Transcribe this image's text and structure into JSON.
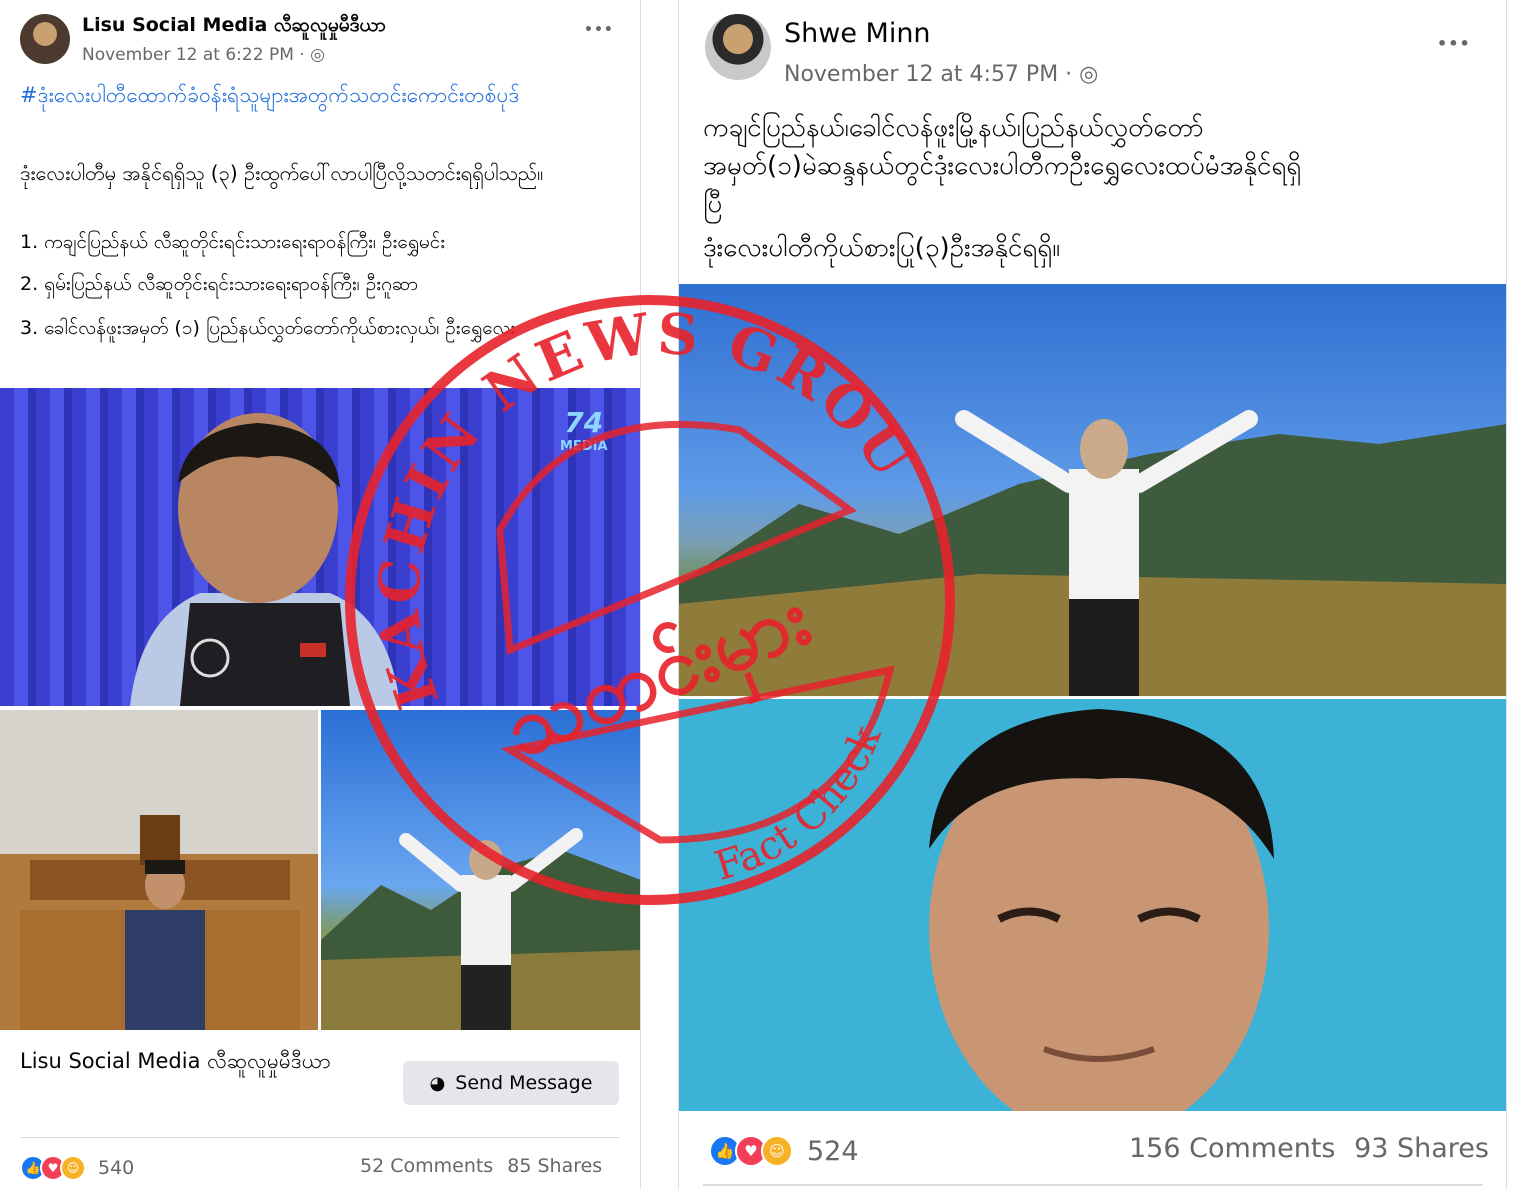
{
  "left": {
    "author": "Lisu Social Media လီဆူလူမှုမီဒီယာ",
    "date": "November 12 at 6:22 PM · ",
    "menu": "•••",
    "hashtag": "#ဒုံးလေးပါတီထောက်ခံဝန်းရံသူများအတွက်သတင်းကောင်းတစ်ပုဒ်",
    "intro": "ဒုံးလေးပါတီမှ အနိုင်ရရှိသူ (၃) ဦးထွက်ပေါ်လာပါပြီလို့သတင်းရရှိပါသည်။",
    "items": [
      "1. ကချင်ပြည်နယ် လီဆူတိုင်းရင်းသားရေးရာဝန်ကြီး၊ ဦးရွှေမင်း",
      "2. ရှမ်းပြည်နယ် လီဆူတိုင်းရင်းသားရေးရာဝန်ကြီး၊ ဦးဂူဆာ",
      "3. ခေါင်လန်ဖူးအမှတ် (၁) ပြည်နယ်လွှတ်တော်ကိုယ်စားလှယ်၊ ဦးရွှေလေး"
    ],
    "photo_logo": "74",
    "photo_logo_sub": "MEDIA",
    "page_name": "Lisu Social Media လီဆူလူမှုမီဒီယာ",
    "send_message": "Send Message",
    "reaction_count": "540",
    "comments": "52 Comments",
    "shares": "85 Shares"
  },
  "right": {
    "author": "Shwe Minn",
    "date": "November 12 at 4:57 PM · ",
    "menu": "•••",
    "text_lines": [
      "ကချင်ပြည်နယ်၊ခေါင်လန်ဖူးမြို့နယ်၊ပြည်နယ်လွှတ်တော်",
      "အမှတ်(၁)မဲဆန္ဒနယ်တွင်ဒုံးလေးပါတီကဦးရွှေလေးထပ်မံအနိုင်ရရှိ",
      "ပြီ",
      "ဒုံးလေးပါတီကိုယ်စားပြု(၃)ဦးအနိုင်ရရှိ။"
    ],
    "reaction_count": "524",
    "comments": "156 Comments",
    "shares": "93 Shares"
  },
  "stamp": {
    "org": "KACHIN NEWS GROUP",
    "verdict": "သတင်းမှား",
    "label": "Fact Check",
    "color": "#e8222b"
  },
  "colors": {
    "link": "#216fdb",
    "like": "#1877f2",
    "love": "#f33e58",
    "care": "#f7b125"
  }
}
